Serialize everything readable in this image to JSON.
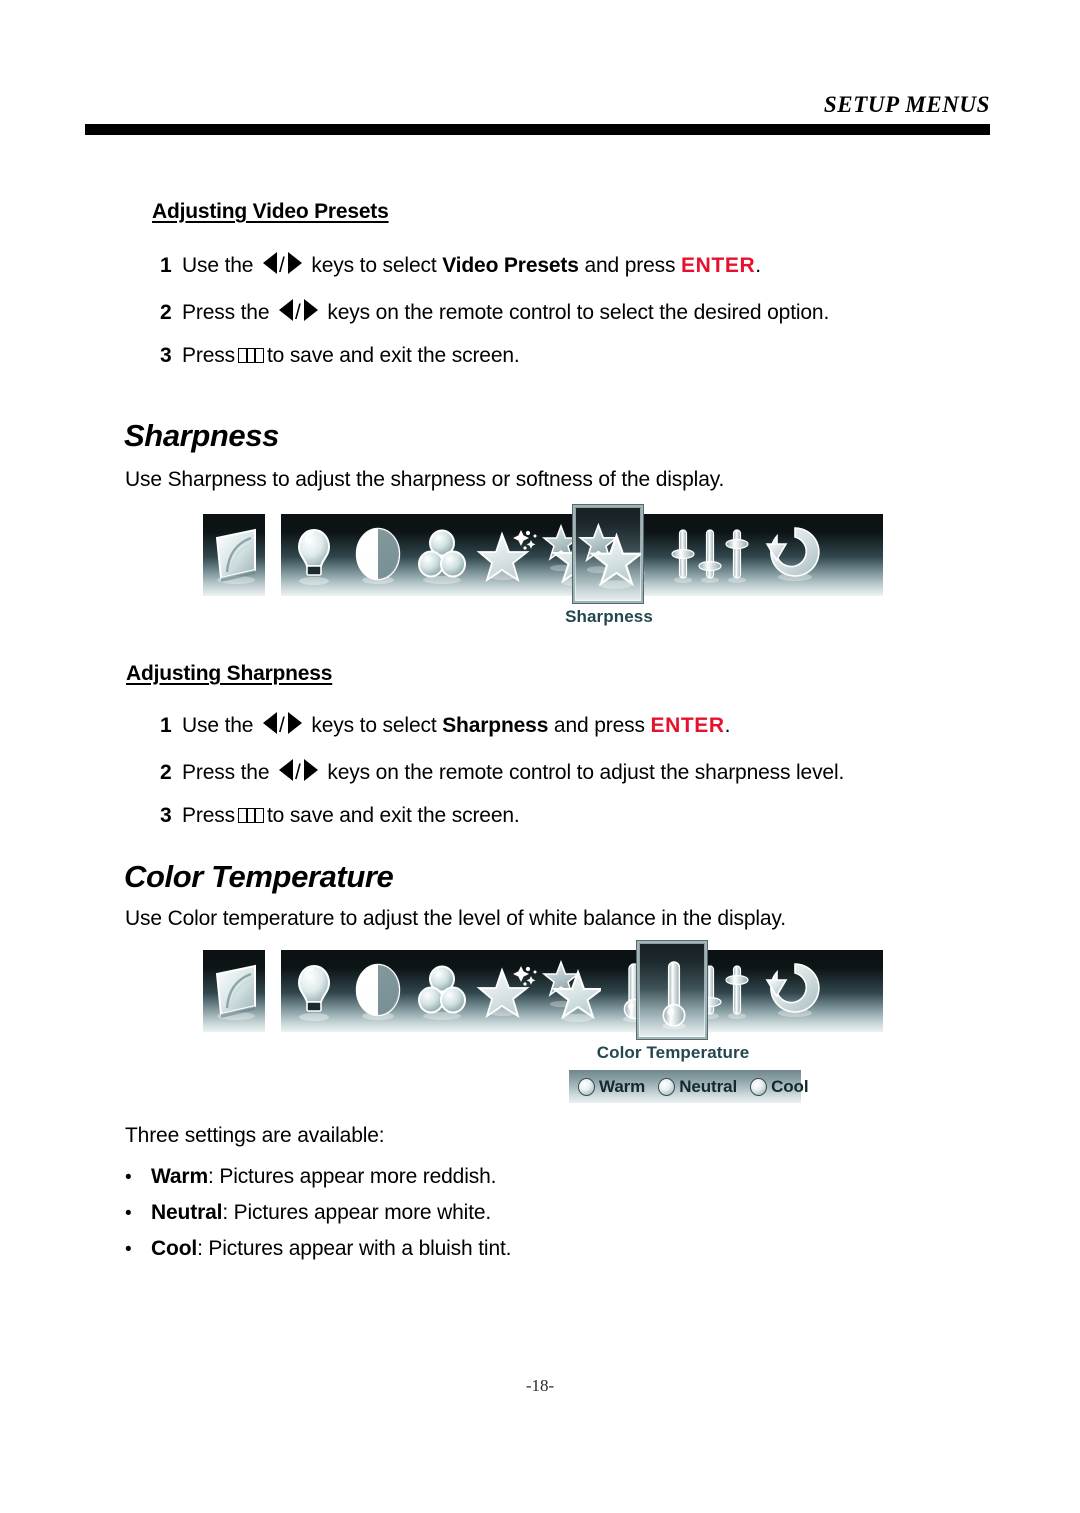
{
  "page": {
    "header_title": "SETUP MENUS",
    "page_number": "-18-"
  },
  "sections": [
    {
      "id": "adjusting_video_presets",
      "heading": "Adjusting Video Presets",
      "steps": [
        {
          "num": "1",
          "pre": "Use the ",
          "mid": " keys to select ",
          "bold": "Video Presets",
          "post": " and press ",
          "key": "ENTER",
          "end": "."
        },
        {
          "num": "2",
          "pre": "Press the ",
          "mid": " keys on the remote control to select the desired option.",
          "bold": "",
          "post": "",
          "key": "",
          "end": ""
        },
        {
          "num": "3",
          "pre": "Press",
          "post": "to save and exit the screen."
        }
      ]
    },
    {
      "id": "sharpness",
      "heading": "Sharpness",
      "description": "Use Sharpness to adjust the sharpness or softness of the display.",
      "sub_heading": "Adjusting Sharpness",
      "steps": [
        {
          "num": "1",
          "pre": "Use the ",
          "mid": " keys to select ",
          "bold": "Sharpness",
          "post": " and press ",
          "key": "ENTER",
          "end": "."
        },
        {
          "num": "2",
          "pre": "Press the ",
          "mid": " keys on the remote control to adjust the sharpness level.",
          "bold": "",
          "post": "",
          "key": "",
          "end": ""
        },
        {
          "num": "3",
          "pre": "Press",
          "post": "to save and exit the screen."
        }
      ]
    },
    {
      "id": "color_temperature",
      "heading": "Color Temperature",
      "description": "Use Color temperature to adjust the level of white balance in the display.",
      "intro": "Three settings are available:",
      "bullets": [
        {
          "term": "Warm",
          "text": ": Pictures appear more reddish."
        },
        {
          "term": "Neutral",
          "text": ": Pictures appear more white."
        },
        {
          "term": "Cool",
          "text": ": Pictures appear with a bluish tint."
        }
      ]
    }
  ],
  "osd_menus": [
    {
      "id": "osd_sharpness",
      "icons": [
        "picture-screen-icon",
        "brightness-bulb-icon",
        "contrast-circle-icon",
        "color-circles-icon",
        "video-presets-magic-star-icon",
        "sharpness-double-star-icon",
        "color-temperature-thermometer-icon",
        "sliders-icon",
        "reset-arrow-icon"
      ],
      "selected_icon": "sharpness-double-star-icon",
      "selected_label": "Sharpness"
    },
    {
      "id": "osd_color_temperature",
      "icons": [
        "picture-screen-icon",
        "brightness-bulb-icon",
        "contrast-circle-icon",
        "color-circles-icon",
        "video-presets-magic-star-icon",
        "sharpness-double-star-icon",
        "color-temperature-thermometer-icon",
        "sliders-icon",
        "reset-arrow-icon"
      ],
      "selected_icon": "color-temperature-thermometer-icon",
      "selected_label": "Color Temperature",
      "options": [
        {
          "label": "Warm"
        },
        {
          "label": "Neutral"
        },
        {
          "label": "Cool"
        }
      ]
    }
  ],
  "colors": {
    "enter_key": "#e8112d",
    "osd_label": "#24474f",
    "rule": "#000000"
  }
}
